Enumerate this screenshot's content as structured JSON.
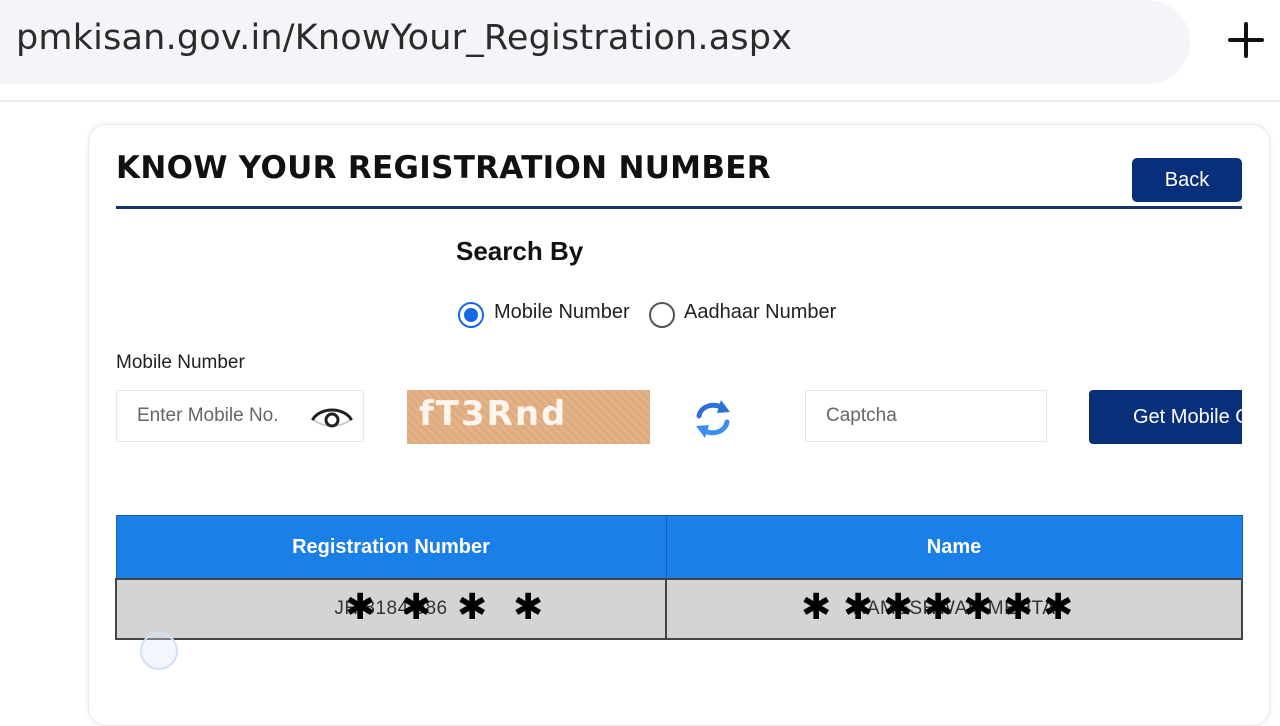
{
  "browser": {
    "url": "pmkisan.gov.in/KnowYour_Registration.aspx",
    "new_tab_icon": "plus-icon"
  },
  "header": {
    "title": "KNOW YOUR REGISTRATION NUMBER",
    "back_label": "Back"
  },
  "search": {
    "heading": "Search By",
    "options": [
      {
        "label": "Mobile Number",
        "checked": true
      },
      {
        "label": "Aadhaar Number",
        "checked": false
      }
    ]
  },
  "form": {
    "mobile_label": "Mobile Number",
    "mobile_placeholder": "Enter Mobile No.",
    "captcha_image_text": "fT3Rnd",
    "captcha_placeholder": "Captcha",
    "submit_label": "Get Mobile OTP"
  },
  "results": {
    "columns": [
      "Registration Number",
      "Name"
    ],
    "rows": [
      {
        "registration_number": "JH 8184 086",
        "name": "RAMESHWAR MEHTA"
      }
    ]
  },
  "colors": {
    "primary_button": "#08307a",
    "table_header": "#1b7fe8",
    "radio_accent": "#1668e6"
  }
}
